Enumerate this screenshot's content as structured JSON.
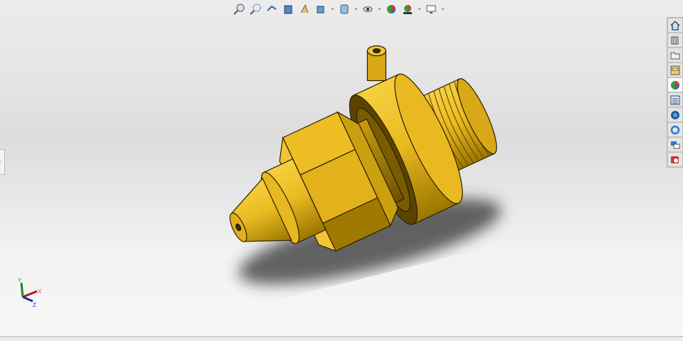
{
  "toolbar": {
    "items": [
      {
        "icon": "zoom-to-fit-icon"
      },
      {
        "icon": "zoom-to-area-icon"
      },
      {
        "icon": "previous-view-icon"
      },
      {
        "icon": "section-view-icon"
      },
      {
        "icon": "dynamic-annotation-icon"
      },
      {
        "icon": "view-orientation-icon"
      },
      {
        "icon": "display-style-icon"
      },
      {
        "icon": "hide-show-items-icon"
      },
      {
        "icon": "edit-appearance-icon"
      },
      {
        "icon": "apply-scene-icon"
      },
      {
        "icon": "view-settings-icon"
      }
    ]
  },
  "taskpane": {
    "items": [
      {
        "icon": "home-icon"
      },
      {
        "icon": "design-library-icon"
      },
      {
        "icon": "file-explorer-icon"
      },
      {
        "icon": "view-palette-icon"
      },
      {
        "icon": "appearances-icon"
      },
      {
        "icon": "custom-properties-icon"
      },
      {
        "icon": "solidworks-resources-icon"
      },
      {
        "icon": "sync-icon"
      },
      {
        "icon": "forum-icon"
      },
      {
        "icon": "add-in-icon"
      }
    ]
  },
  "triad": {
    "x": "X",
    "y": "Y",
    "z": "Z"
  },
  "colors": {
    "part": "#e8b820",
    "edge": "#2a2000"
  }
}
